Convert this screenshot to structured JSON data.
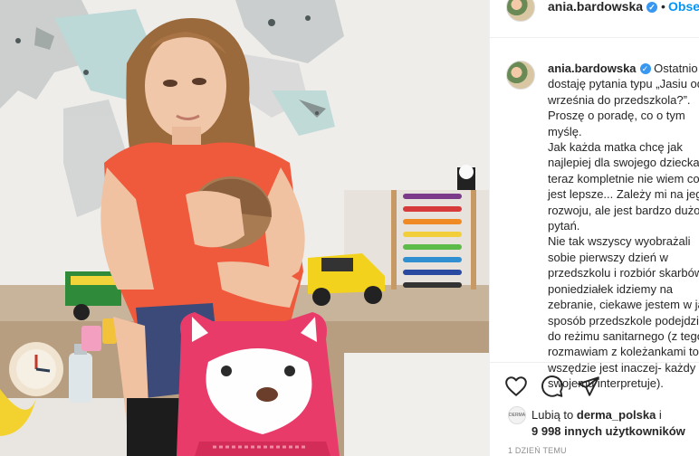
{
  "header": {
    "username": "ania.bardowska",
    "separator": "•",
    "follow_label": "Obserwuj"
  },
  "caption": {
    "username": "ania.bardowska",
    "text": " Ostatnio dostaję pytania typu „Jasiu od września do przedszkola?”. Proszę o poradę, co o tym myślę.\nJak każda matka chcę jak najlepiej dla swojego dziecka, a teraz kompletnie nie wiem co jest lepsze... Zależy mi na jego rozwoju, ale jest bardzo dużo pytań.\nNie tak wszyscy wyobrażali sobie pierwszy dzień w przedszkolu i rozbiór skarbów. W poniedziałek idziemy na zebranie, ciekawe jestem w jaki sposób przedszkole podejdzie do reżimu sanitarnego (z tego co rozmawiam z koleżankami to wszędzie jest inaczej- każdy po swojemu interpretuje)."
  },
  "likes": {
    "avatar_text": "DERMA",
    "prefix": "Lubią to ",
    "liker": "derma_polska",
    "suffix": " i",
    "others": "9 998 innych użytkowników"
  },
  "timestamp": "1 DZIEŃ TEMU",
  "icons": [
    "heart-icon",
    "comment-icon",
    "share-icon",
    "verified-icon"
  ],
  "colors": {
    "accent": "#0095f6",
    "verified": "#3897f0",
    "text": "#262626",
    "muted": "#8e8e8e"
  }
}
